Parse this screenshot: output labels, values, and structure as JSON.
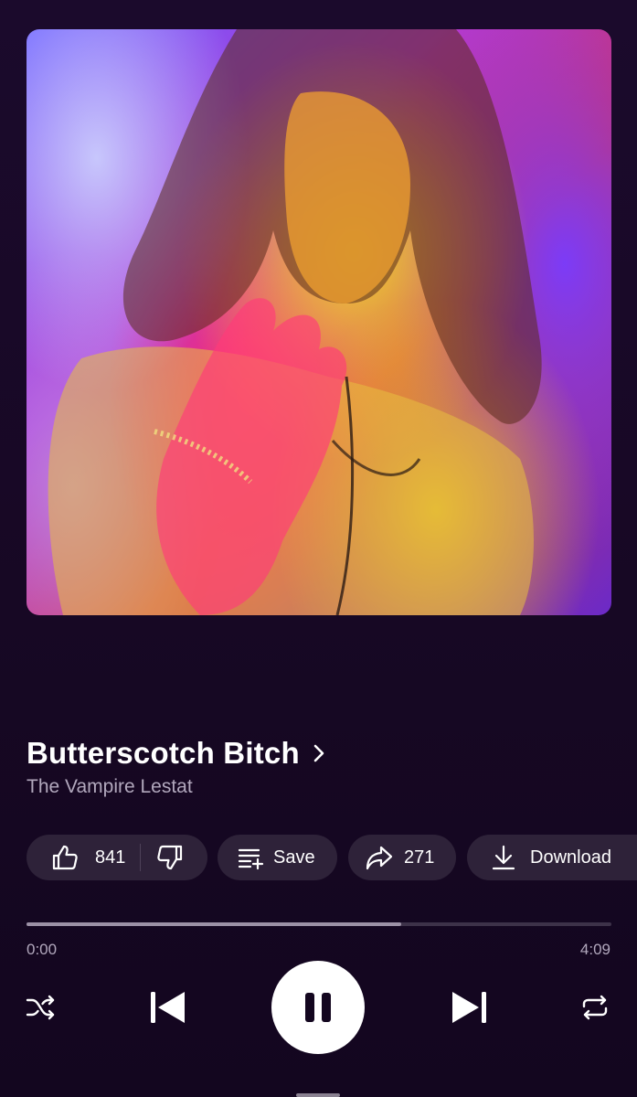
{
  "album_art": {
    "description": "album-cover",
    "colors": [
      "#6a5cff",
      "#d8324f",
      "#f0dc28",
      "#ff2878"
    ]
  },
  "track": {
    "title": "Butterscotch Bitch",
    "artist": "The Vampire Lestat"
  },
  "actions": {
    "like_count": "841",
    "save_label": "Save",
    "share_count": "271",
    "download_label": "Download"
  },
  "playback": {
    "current_time": "0:00",
    "duration": "4:09",
    "buffered_fraction": 0.64,
    "state": "playing"
  },
  "icons": {
    "like": "thumbs-up-icon",
    "dislike": "thumbs-down-icon",
    "save": "playlist-add-icon",
    "share": "share-icon",
    "download": "download-icon",
    "shuffle": "shuffle-icon",
    "previous": "skip-previous-icon",
    "pause": "pause-icon",
    "next": "skip-next-icon",
    "repeat": "repeat-icon"
  },
  "colors": {
    "background": "#1b0a2c",
    "pill": "#2e2239",
    "secondary_text": "#b2a8bd",
    "track": "#3d3249",
    "track_fill": "#9c91a6"
  }
}
